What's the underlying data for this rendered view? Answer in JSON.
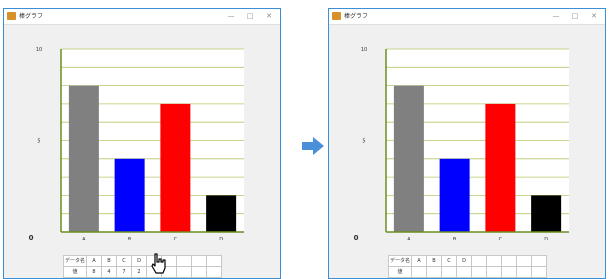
{
  "windows": [
    {
      "title": "棒グラフ",
      "controls": {
        "minimize": "—",
        "maximize": "□",
        "close": "✕"
      },
      "table": {
        "row_header_1": "データ名",
        "row_header_2": "値",
        "names": [
          "A",
          "B",
          "C",
          "D",
          "",
          "",
          "",
          "",
          ""
        ],
        "values": [
          "8",
          "4",
          "7",
          "2",
          "",
          "",
          "",
          "",
          ""
        ]
      }
    },
    {
      "title": "棒グラフ",
      "controls": {
        "minimize": "—",
        "maximize": "□",
        "close": "✕"
      },
      "table": {
        "row_header_1": "データ名",
        "row_header_2": "値",
        "names": [
          "A",
          "B",
          "C",
          "D",
          "",
          "",
          "",
          "",
          ""
        ],
        "values": [
          "",
          "",
          "",
          "",
          "",
          "",
          "",
          "",
          ""
        ]
      }
    }
  ],
  "colors": {
    "accent_border": "#3a8fd6",
    "arrow": "#4a90d9",
    "axis": "#6b8e23",
    "gridline": "#b8c86a"
  },
  "chart_data": [
    {
      "type": "bar",
      "categories": [
        "A",
        "B",
        "C",
        "D"
      ],
      "values": [
        8,
        4,
        7,
        2
      ],
      "colors": [
        "#808080",
        "#0000ff",
        "#ff0000",
        "#000000"
      ],
      "y_ticks": [
        "10",
        "5",
        "0"
      ],
      "ylim": [
        0,
        10
      ],
      "grid": true
    },
    {
      "type": "bar",
      "categories": [
        "A",
        "B",
        "C",
        "D"
      ],
      "values": [
        8,
        4,
        7,
        2
      ],
      "colors": [
        "#808080",
        "#0000ff",
        "#ff0000",
        "#000000"
      ],
      "y_ticks": [
        "10",
        "5",
        "0"
      ],
      "ylim": [
        0,
        10
      ],
      "grid": true
    }
  ]
}
